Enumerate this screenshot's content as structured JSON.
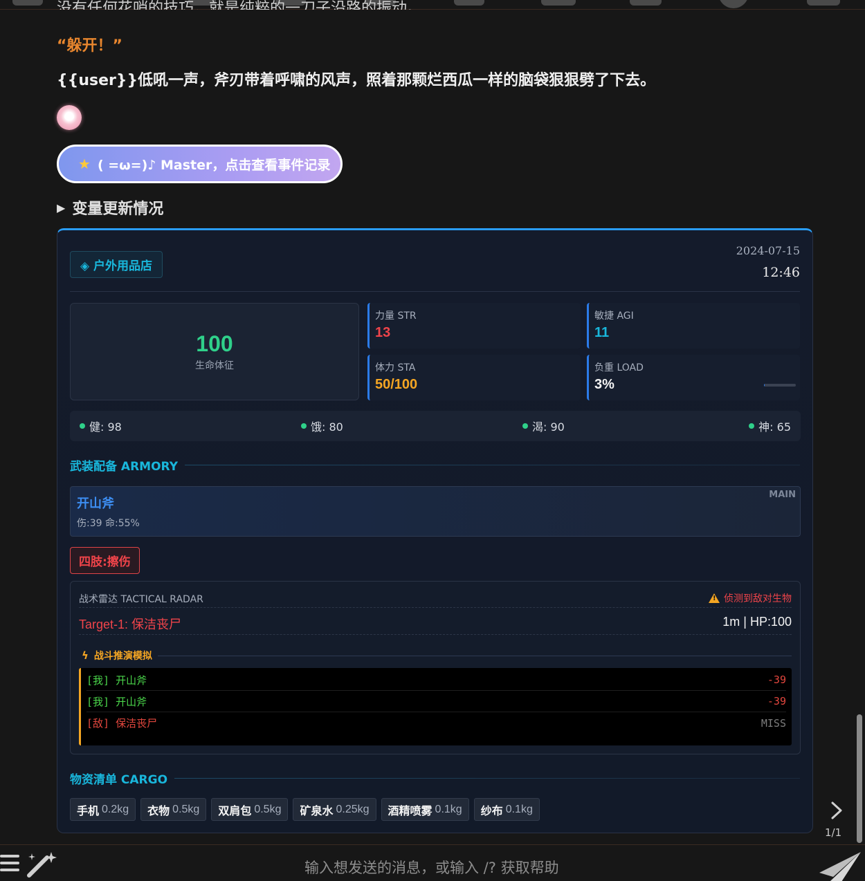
{
  "chat": {
    "cut_line": "没有任何花哨的技巧，就是纯粹的一刀子沿路的振动。",
    "line_shout": "“躲开！”",
    "line_action": "{{user}}低吼一声，斧刃带着呼啸的风声，照着那颗烂西瓜一样的脑袋狠狠劈了下去。",
    "event_button_label": "( =ω=)♪ Master，点击查看事件记录",
    "variables_toggle": "变量更新情况"
  },
  "status": {
    "location": "◈ 户外用品店",
    "date": "2024-07-15",
    "time": "12:46",
    "vital_value": "100",
    "vital_label": "生命体征",
    "stats": [
      {
        "label": "力量 STR",
        "value": "13",
        "color": "#f0444a"
      },
      {
        "label": "敏捷 AGI",
        "value": "11",
        "color": "#19b7dc"
      },
      {
        "label": "体力 STA",
        "value": "50/100",
        "color": "#f5a623"
      },
      {
        "label": "负重 LOAD",
        "value": "3%",
        "color": "#f4f4f4"
      }
    ],
    "load_fraction": 0.03,
    "needs": [
      {
        "label": "健: 98"
      },
      {
        "label": "饿: 80"
      },
      {
        "label": "渴: 90"
      },
      {
        "label": "神: 65"
      }
    ]
  },
  "armory": {
    "title": "武装配备 ARMORY",
    "weapon_name": "开山斧",
    "weapon_stats": "伤:39  命:55%",
    "weapon_tag": "MAIN"
  },
  "injury": "四肢:擦伤",
  "radar": {
    "title": "战术雷达 TACTICAL RADAR",
    "warning": "侦测到敌对生物",
    "target": "Target-1: 保洁丧尸",
    "target_info": "1m | HP:100",
    "sim_title": "战斗推演模拟",
    "log": [
      {
        "actor": "[我] 开山斧",
        "result": "-39",
        "side": "ally"
      },
      {
        "actor": "[我] 开山斧",
        "result": "-39",
        "side": "ally"
      },
      {
        "actor": "[敌] 保洁丧尸",
        "result": "MISS",
        "side": "enemy"
      }
    ]
  },
  "cargo": {
    "title": "物资清单 CARGO",
    "items": [
      {
        "name": "手机",
        "weight": "0.2kg"
      },
      {
        "name": "衣物",
        "weight": "0.5kg"
      },
      {
        "name": "双肩包",
        "weight": "0.5kg"
      },
      {
        "name": "矿泉水",
        "weight": "0.25kg"
      },
      {
        "name": "酒精喷雾",
        "weight": "0.1kg"
      },
      {
        "name": "纱布",
        "weight": "0.1kg"
      }
    ]
  },
  "pager": "1/1",
  "input": {
    "placeholder": "输入想发送的消息，或输入 /? 获取帮助"
  },
  "icons": {
    "menu": "hamburger-menu-icon",
    "wand": "magic-wand-icon",
    "send": "paper-plane-icon",
    "next": "chevron-right-icon",
    "star": "star-icon",
    "warning": "warning-triangle-icon",
    "bolt": "lightning-bolt-icon"
  },
  "colors": {
    "accent": "#19b7dc",
    "vital": "#2fd08a",
    "danger": "#f0444a",
    "warning": "#f5a623"
  }
}
